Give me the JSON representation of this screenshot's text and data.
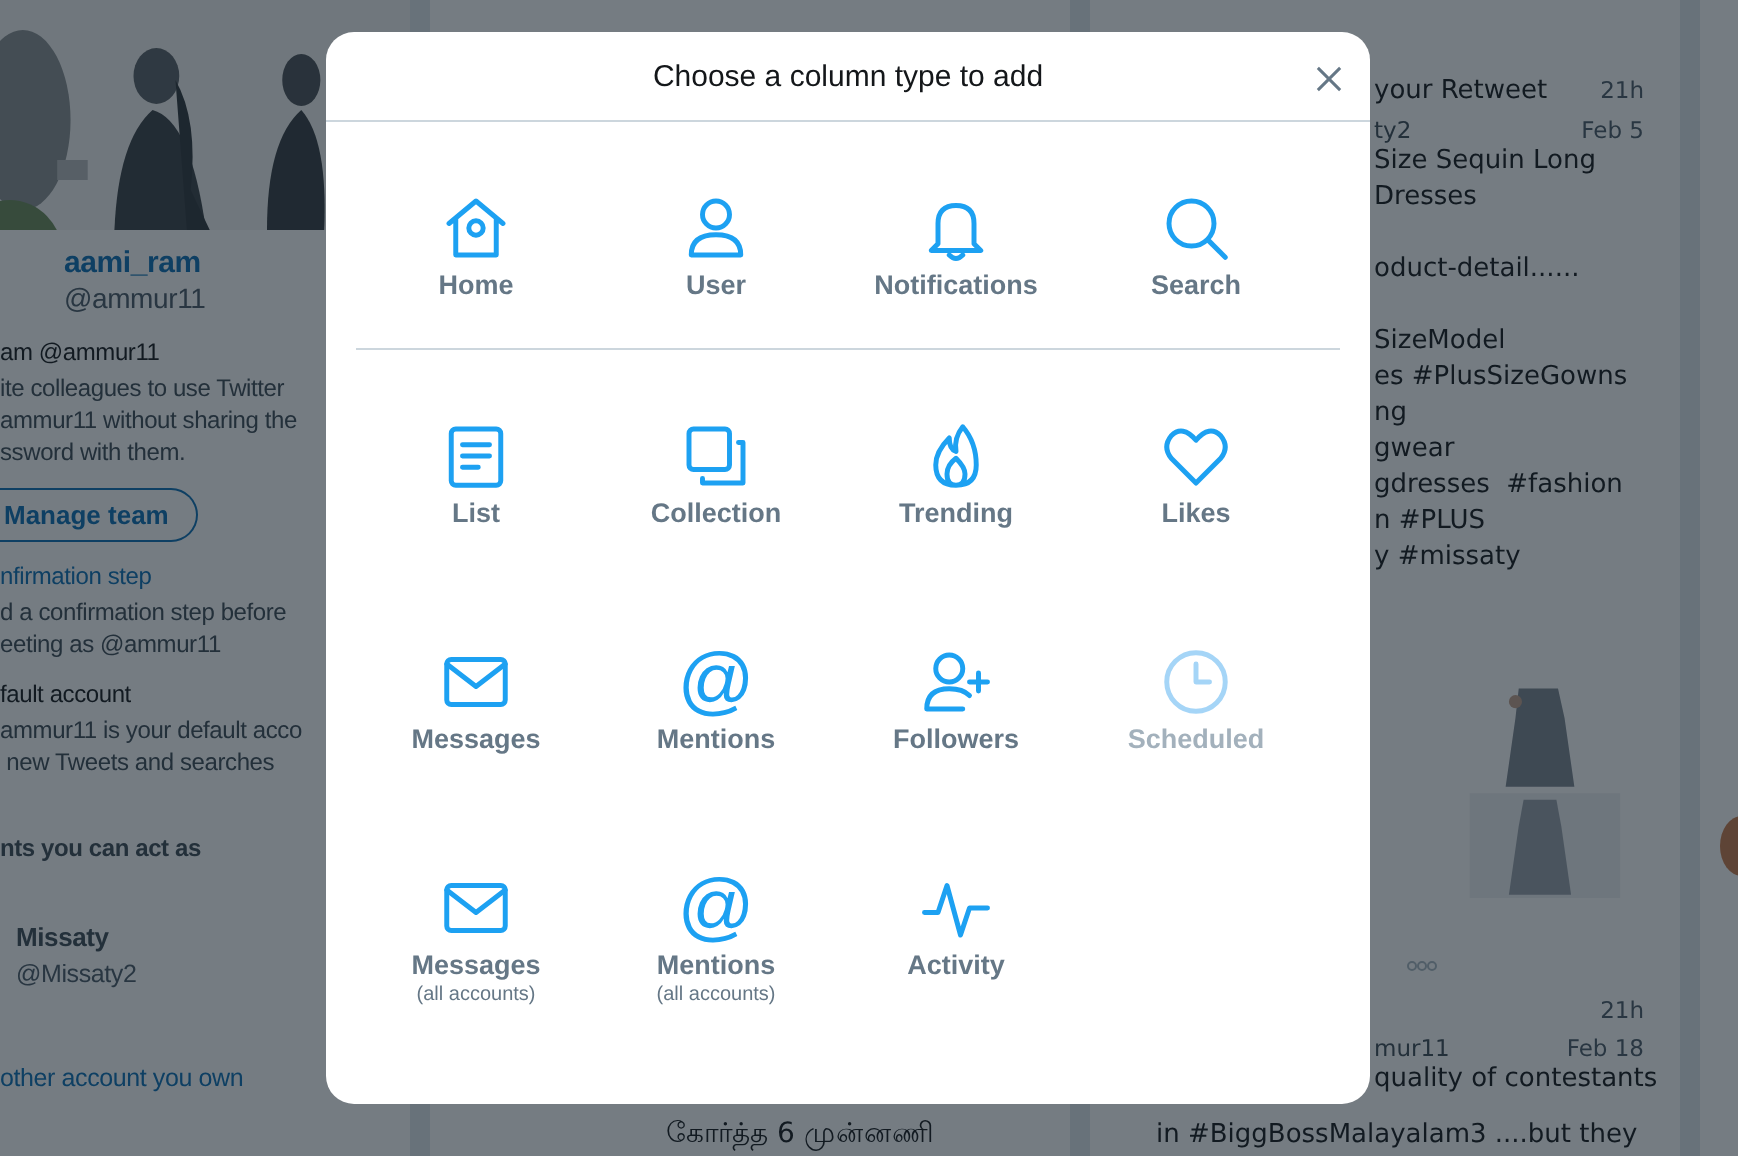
{
  "left_column": {
    "profile_name": "aami_ram",
    "profile_handle": "@ammur11",
    "team_title": "am @ammur11",
    "team_text": [
      "ite colleagues to use Twitter",
      "ammur11 without sharing the",
      "ssword with them."
    ],
    "manage_button": "Manage team",
    "confirm_title": "nfirmation step",
    "confirm_text": [
      "d a confirmation step before",
      "eeting as @ammur11"
    ],
    "default_title": "fault account",
    "default_text": [
      "ammur11 is your default acco",
      " new Tweets and searches"
    ],
    "act_as_title": "nts you can act as",
    "account_name": "Missaty",
    "account_handle": "@Missaty2",
    "add_link": "other account you own"
  },
  "middle_column": {
    "tweet_line": "கோர்த்த 6 முன்னணி"
  },
  "right_column": {
    "top_tweet": {
      "title": "your Retweet",
      "time": "21h",
      "handle": "ty2",
      "date": "Feb 5",
      "paragraphs": [
        [
          "Size Sequin Long",
          "Dresses"
        ],
        [
          "oduct-detail......"
        ],
        [
          "SizeModel",
          "es #PlusSizeGowns",
          "ng",
          "gwear",
          "gdresses  #fashion",
          "n #PLUS",
          "y #missaty"
        ]
      ]
    },
    "bottom_tweet": {
      "time": "21h",
      "handle": "mur11",
      "date": "Feb 18",
      "line_1": "quality of contestants",
      "line_2": "in #BiggBossMalayalam3 ....but they"
    }
  },
  "modal": {
    "title": "Choose a column type to add",
    "sections": [
      {
        "items": [
          {
            "label": "Home",
            "disabled": false
          },
          {
            "label": "User",
            "disabled": false
          },
          {
            "label": "Notifications",
            "disabled": false
          },
          {
            "label": "Search",
            "disabled": false
          }
        ]
      },
      {
        "items": [
          {
            "label": "List",
            "disabled": false
          },
          {
            "label": "Collection",
            "disabled": false
          },
          {
            "label": "Trending",
            "disabled": false
          },
          {
            "label": "Likes",
            "disabled": false
          },
          {
            "label": "Messages",
            "disabled": false
          },
          {
            "label": "Mentions",
            "glyph": "@",
            "disabled": false
          },
          {
            "label": "Followers",
            "disabled": false
          },
          {
            "label": "Scheduled",
            "disabled": true
          },
          {
            "label": "Messages",
            "sublabel": "(all accounts)",
            "disabled": false
          },
          {
            "label": "Mentions",
            "sublabel": "(all accounts)",
            "glyph": "@",
            "disabled": false
          },
          {
            "label": "Activity",
            "disabled": false
          }
        ]
      }
    ]
  }
}
